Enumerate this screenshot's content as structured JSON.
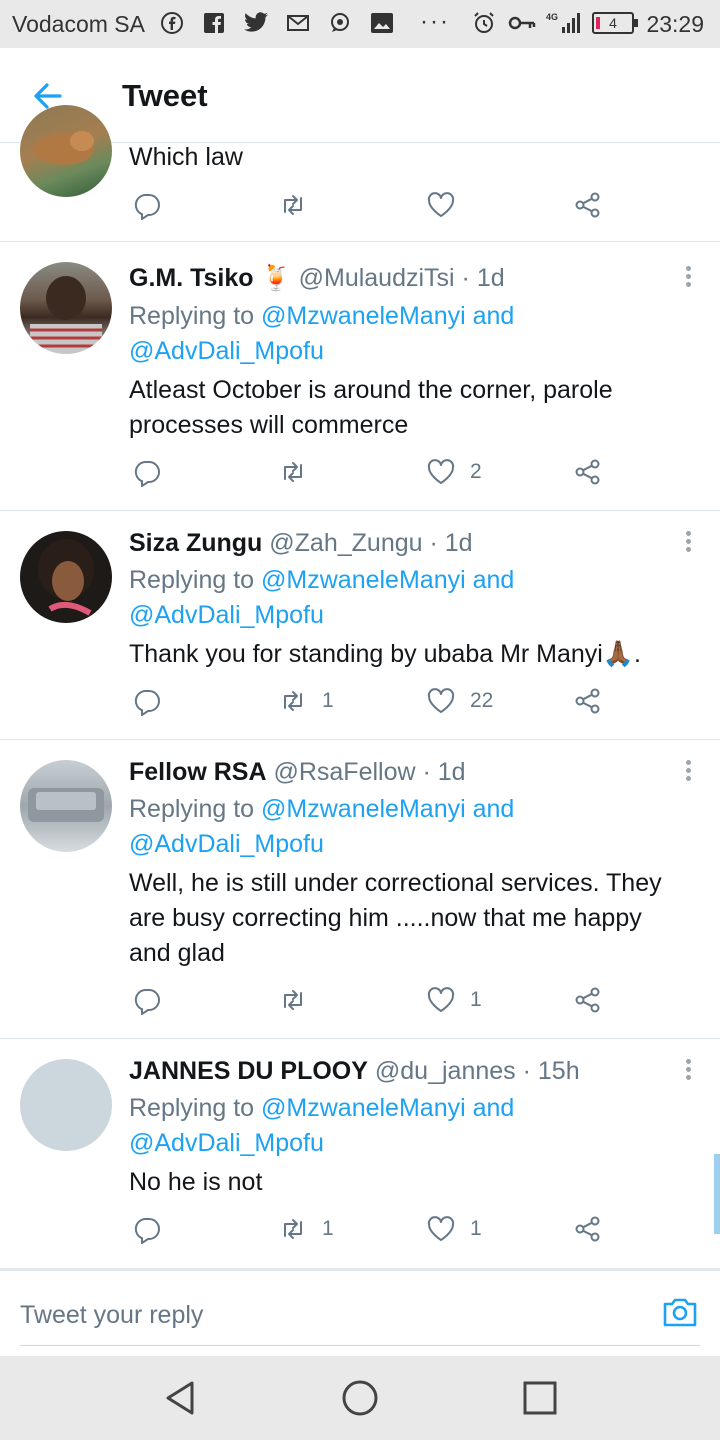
{
  "status_bar": {
    "carrier": "Vodacom SA",
    "network": "4G",
    "battery": "4",
    "time": "23:29"
  },
  "header": {
    "title": "Tweet"
  },
  "tweets": [
    {
      "text": "Which law",
      "replies": "",
      "retweets": "",
      "likes": ""
    },
    {
      "name": "G.M. Tsiko",
      "emoji": "🍹",
      "handle": "@MulaudziTsi",
      "sep": "·",
      "time": "1d",
      "replying_prefix": "Replying to",
      "mention1": "@MzwaneleManyi",
      "and": "and",
      "mention2": "@AdvDali_Mpofu",
      "text": "Atleast October is around the corner, parole processes will commerce",
      "retweets": "",
      "likes": "2"
    },
    {
      "name": "Siza Zungu",
      "handle": "@Zah_Zungu",
      "sep": "·",
      "time": "1d",
      "replying_prefix": "Replying to",
      "mention1": "@MzwaneleManyi",
      "and": "and",
      "mention2": "@AdvDali_Mpofu",
      "text": "Thank you for standing by ubaba Mr Manyi🙏🏾.",
      "retweets": "1",
      "likes": "22"
    },
    {
      "name": "Fellow RSA",
      "handle": "@RsaFellow",
      "sep": "·",
      "time": "1d",
      "replying_prefix": "Replying to",
      "mention1": "@MzwaneleManyi",
      "and": "and",
      "mention2": "@AdvDali_Mpofu",
      "text": "Well, he is still under correctional services. They are busy correcting him .....now that me happy and glad",
      "retweets": "",
      "likes": "1"
    },
    {
      "name": "JANNES DU PLOOY",
      "handle": "@du_jannes",
      "sep": "·",
      "time": "15h",
      "replying_prefix": "Replying to",
      "mention1": "@MzwaneleManyi",
      "and": "and",
      "mention2": "@AdvDali_Mpofu",
      "text": "No he is not",
      "retweets": "1",
      "likes": "1"
    }
  ],
  "reply_bar": {
    "placeholder": "Tweet your reply"
  },
  "colors": {
    "accent": "#1da1f2",
    "secondary_text": "#657786",
    "divider": "#e1e8ed"
  },
  "icons": [
    "back-arrow-icon",
    "reply-icon",
    "retweet-icon",
    "like-icon",
    "share-icon",
    "more-icon",
    "camera-icon",
    "nav-back-icon",
    "nav-home-icon",
    "nav-recents-icon"
  ]
}
